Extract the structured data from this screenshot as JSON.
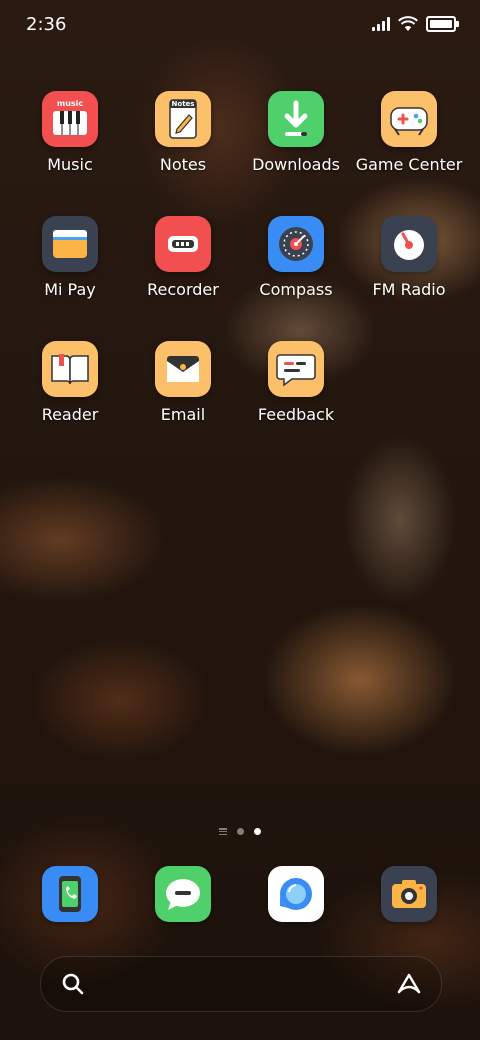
{
  "status_bar": {
    "time": "2:36"
  },
  "apps": [
    {
      "id": "music",
      "label": "Music",
      "icon_text": "music"
    },
    {
      "id": "notes",
      "label": "Notes",
      "icon_text": "Notes"
    },
    {
      "id": "downloads",
      "label": "Downloads"
    },
    {
      "id": "game-center",
      "label": "Game Center"
    },
    {
      "id": "mi-pay",
      "label": "Mi Pay"
    },
    {
      "id": "recorder",
      "label": "Recorder"
    },
    {
      "id": "compass",
      "label": "Compass"
    },
    {
      "id": "fm-radio",
      "label": "FM Radio"
    },
    {
      "id": "reader",
      "label": "Reader"
    },
    {
      "id": "email",
      "label": "Email"
    },
    {
      "id": "feedback",
      "label": "Feedback"
    }
  ],
  "dock": [
    "phone",
    "messages",
    "browser",
    "camera"
  ],
  "page_indicator": {
    "pages": 2,
    "active": 2
  },
  "colors": {
    "red_icon": "#f25050",
    "orange_icon": "#fcc06a",
    "green_icon": "#4fd06a",
    "blue_icon": "#3a8cf5",
    "slate_icon": "#3a4252"
  }
}
